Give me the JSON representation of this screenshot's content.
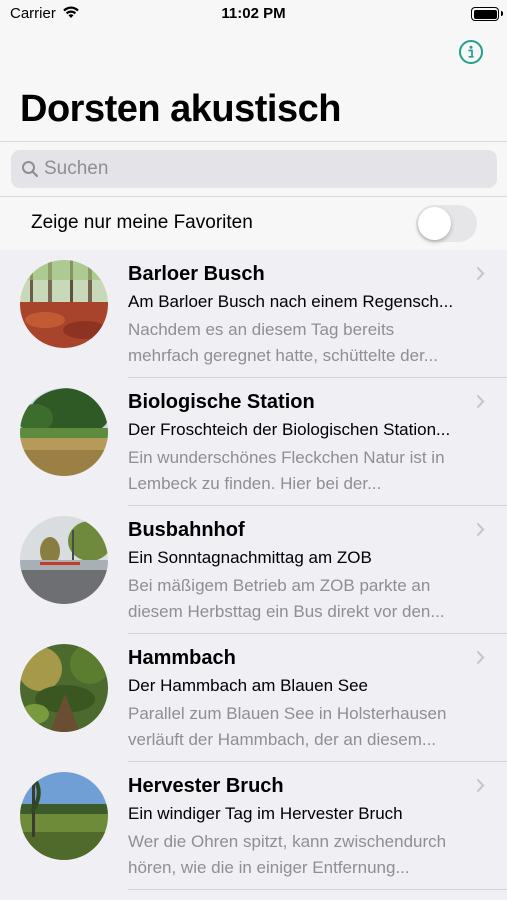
{
  "status": {
    "carrier": "Carrier",
    "time": "11:02 PM"
  },
  "nav": {
    "title": "Dorsten akustisch",
    "info_icon": "info-circle-icon",
    "accent": "#1fa08e"
  },
  "search": {
    "placeholder": "Suchen",
    "value": ""
  },
  "favorites": {
    "label": "Zeige nur meine Favoriten",
    "enabled": false
  },
  "items": [
    {
      "title": "Barloer Busch",
      "subtitle": "Am Barloer Busch nach einem Regensch...",
      "desc1": "Nachdem es an diesem Tag bereits",
      "desc2": "mehrfach geregnet hatte, schüttelte der..."
    },
    {
      "title": "Biologische Station",
      "subtitle": "Der Froschteich der Biologischen Station...",
      "desc1": "Ein wunderschönes Fleckchen Natur ist in",
      "desc2": "Lembeck zu finden. Hier bei der..."
    },
    {
      "title": "Busbahnhof",
      "subtitle": "Ein Sonntagnachmittag am ZOB",
      "desc1": "Bei mäßigem Betrieb am ZOB parkte an",
      "desc2": "diesem Herbsttag ein Bus direkt vor den..."
    },
    {
      "title": "Hammbach",
      "subtitle": "Der Hammbach am Blauen See",
      "desc1": "Parallel zum Blauen See in Holsterhausen",
      "desc2": "verläuft der Hammbach, der an diesem..."
    },
    {
      "title": "Hervester Bruch",
      "subtitle": "Ein windiger Tag im Hervester Bruch",
      "desc1": "Wer die Ohren spitzt, kann zwischendurch",
      "desc2": "hören, wie die in einiger Entfernung..."
    }
  ]
}
